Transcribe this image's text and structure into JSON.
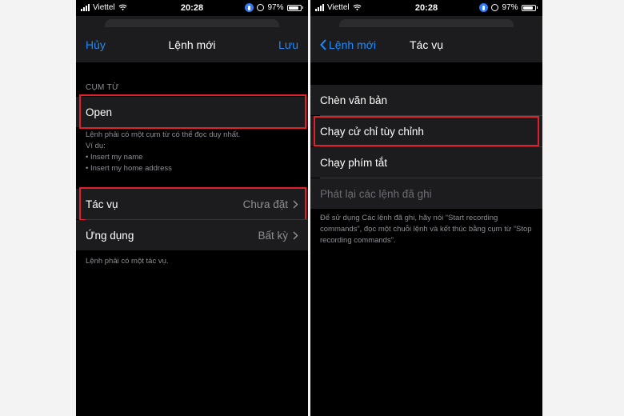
{
  "status_bar": {
    "carrier": "Viettel",
    "time": "20:28",
    "battery": "97%"
  },
  "left_screen": {
    "nav": {
      "cancel": "Hủy",
      "title": "Lệnh mới",
      "save": "Lưu"
    },
    "phrase_section": {
      "header": "CỤM TỪ",
      "value": "Open",
      "help_line1": "Lệnh phải có một cụm từ có thể đọc duy nhất.",
      "help_line2": "Ví dụ:",
      "example1": "• Insert my name",
      "example2": "• Insert my home address"
    },
    "action_row": {
      "label": "Tác vụ",
      "value": "Chưa đặt"
    },
    "app_row": {
      "label": "Ứng dụng",
      "value": "Bất kỳ"
    },
    "footer": "Lệnh phải có một tác vụ."
  },
  "right_screen": {
    "nav": {
      "back": "Lệnh mới",
      "title": "Tác vụ"
    },
    "options": [
      {
        "label": "Chèn văn bản"
      },
      {
        "label": "Chạy cử chỉ tùy chỉnh"
      },
      {
        "label": "Chạy phím tắt"
      },
      {
        "label": "Phát lại các lệnh đã ghi"
      }
    ],
    "footer": "Để sử dụng Các lệnh đã ghi, hãy nói “Start recording commands”, đọc một chuỗi lệnh và kết thúc bằng cụm từ “Stop recording commands”."
  },
  "colors": {
    "accent": "#1a8cff",
    "highlight": "#e0202a",
    "row_background": "#1c1c1e",
    "secondary_text": "#8e8e93"
  }
}
